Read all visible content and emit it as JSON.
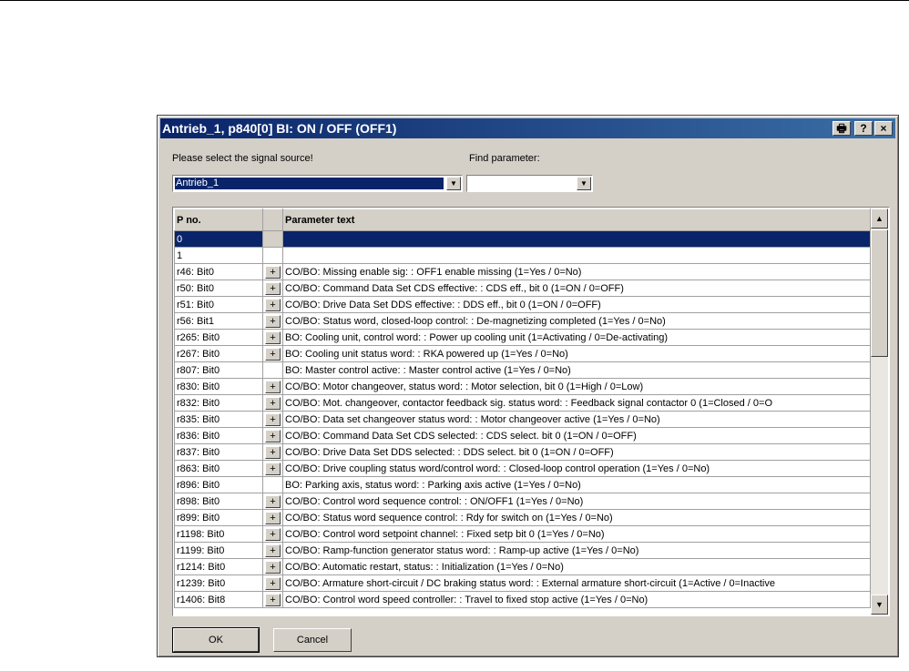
{
  "dialog": {
    "title": "Antrieb_1, p840[0] BI: ON / OFF (OFF1)",
    "print_glyph": "🖶",
    "help_glyph": "?",
    "close_glyph": "×"
  },
  "labels": {
    "signal_source": "Please select the signal source!",
    "find_parameter": "Find parameter:"
  },
  "signal_source": {
    "value": "Antrieb_1"
  },
  "find_parameter": {
    "value": ""
  },
  "table": {
    "headers": [
      "P no.",
      "",
      "Parameter text"
    ],
    "rows": [
      {
        "p": "0",
        "plus": false,
        "text": ""
      },
      {
        "p": "1",
        "plus": false,
        "text": ""
      },
      {
        "p": "r46: Bit0",
        "plus": true,
        "text": "CO/BO: Missing enable sig: : OFF1 enable missing (1=Yes / 0=No)"
      },
      {
        "p": "r50: Bit0",
        "plus": true,
        "text": "CO/BO: Command Data Set CDS effective: : CDS eff., bit 0 (1=ON / 0=OFF)"
      },
      {
        "p": "r51: Bit0",
        "plus": true,
        "text": "CO/BO: Drive Data Set DDS effective: : DDS eff., bit 0 (1=ON / 0=OFF)"
      },
      {
        "p": "r56: Bit1",
        "plus": true,
        "text": "CO/BO: Status word, closed-loop control: : De-magnetizing completed (1=Yes / 0=No)"
      },
      {
        "p": "r265: Bit0",
        "plus": true,
        "text": "BO: Cooling unit, control word: : Power up cooling unit (1=Activating / 0=De-activating)"
      },
      {
        "p": "r267: Bit0",
        "plus": true,
        "text": "BO: Cooling unit status word: : RKA powered up (1=Yes / 0=No)"
      },
      {
        "p": "r807: Bit0",
        "plus": false,
        "text": "BO: Master control active: : Master control active (1=Yes / 0=No)"
      },
      {
        "p": "r830: Bit0",
        "plus": true,
        "text": "CO/BO: Motor changeover, status word: : Motor selection, bit 0 (1=High / 0=Low)"
      },
      {
        "p": "r832: Bit0",
        "plus": true,
        "text": "CO/BO: Mot. changeover, contactor feedback sig. status word: : Feedback signal contactor 0 (1=Closed / 0=O"
      },
      {
        "p": "r835: Bit0",
        "plus": true,
        "text": "CO/BO: Data set changeover status word: : Motor changeover active (1=Yes / 0=No)"
      },
      {
        "p": "r836: Bit0",
        "plus": true,
        "text": "CO/BO: Command Data Set CDS selected: : CDS select. bit 0 (1=ON / 0=OFF)"
      },
      {
        "p": "r837: Bit0",
        "plus": true,
        "text": "CO/BO: Drive Data Set DDS selected: : DDS select. bit 0 (1=ON / 0=OFF)"
      },
      {
        "p": "r863: Bit0",
        "plus": true,
        "text": "CO/BO: Drive coupling status word/control word: : Closed-loop control operation (1=Yes / 0=No)"
      },
      {
        "p": "r896: Bit0",
        "plus": false,
        "text": "BO: Parking axis, status word: : Parking axis active (1=Yes / 0=No)"
      },
      {
        "p": "r898: Bit0",
        "plus": true,
        "text": "CO/BO: Control word sequence control: : ON/OFF1 (1=Yes / 0=No)"
      },
      {
        "p": "r899: Bit0",
        "plus": true,
        "text": "CO/BO: Status word sequence control: : Rdy for switch on (1=Yes / 0=No)"
      },
      {
        "p": "r1198: Bit0",
        "plus": true,
        "text": "CO/BO: Control word setpoint channel: : Fixed setp bit 0 (1=Yes / 0=No)"
      },
      {
        "p": "r1199: Bit0",
        "plus": true,
        "text": "CO/BO: Ramp-function generator status word: : Ramp-up active (1=Yes / 0=No)"
      },
      {
        "p": "r1214: Bit0",
        "plus": true,
        "text": "CO/BO: Automatic restart, status: : Initialization (1=Yes / 0=No)"
      },
      {
        "p": "r1239: Bit0",
        "plus": true,
        "text": "CO/BO: Armature short-circuit / DC braking status word: : External armature short-circuit (1=Active / 0=Inactive"
      },
      {
        "p": "r1406: Bit8",
        "plus": true,
        "text": "CO/BO: Control word speed controller: : Travel to fixed stop active (1=Yes / 0=No)"
      }
    ]
  },
  "buttons": {
    "ok": "OK",
    "cancel": "Cancel",
    "plus": "+"
  },
  "scroll": {
    "up": "▲",
    "down": "▼",
    "drop": "▼"
  },
  "colors": {
    "selection": "#0a246a",
    "face": "#d4d0c8"
  }
}
